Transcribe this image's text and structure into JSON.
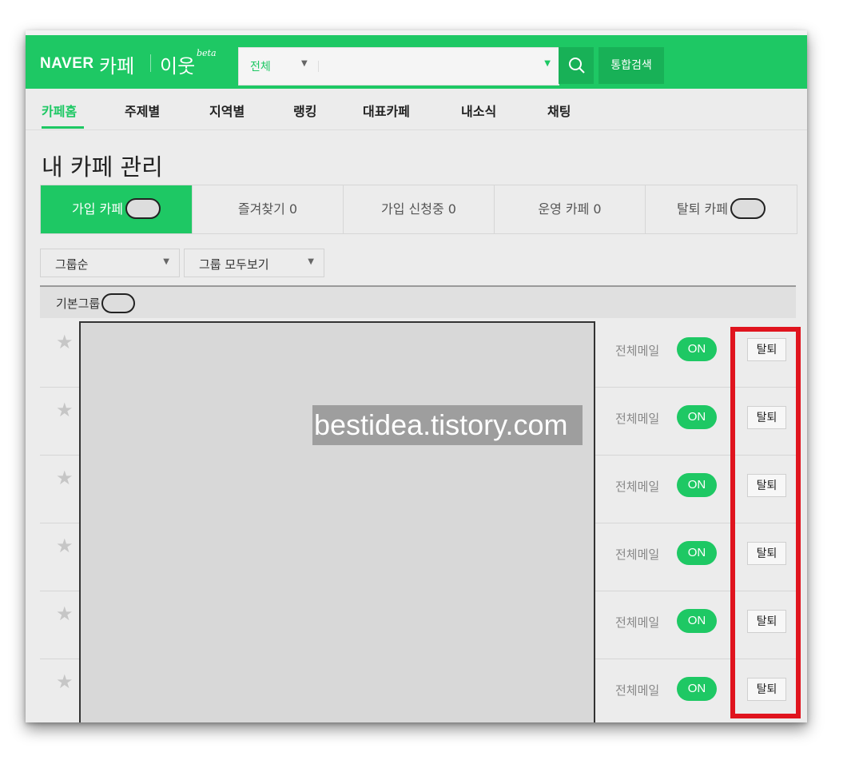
{
  "header": {
    "logo_naver": "NAVER",
    "logo_cafe": "카페",
    "logo_iut": "이웃",
    "logo_beta": "beta",
    "search_scope": "전체",
    "search_placeholder": "",
    "unified_search_label": "통합검색",
    "brand_color": "#1ec864"
  },
  "nav": {
    "items": [
      {
        "label": "카페홈",
        "active": true
      },
      {
        "label": "주제별"
      },
      {
        "label": "지역별"
      },
      {
        "label": "랭킹"
      },
      {
        "label": "대표카페"
      },
      {
        "label": "내소식"
      },
      {
        "label": "채팅"
      }
    ]
  },
  "page_title": "내 카페 관리",
  "tabs": [
    {
      "label": "가입 카페",
      "active": true
    },
    {
      "label": "즐겨찾기 0"
    },
    {
      "label": "가입 신청중 0"
    },
    {
      "label": "운영 카페 0"
    },
    {
      "label": "탈퇴 카페"
    }
  ],
  "filters": {
    "sort_label": "그룹순",
    "group_label": "그룹 모두보기"
  },
  "group": {
    "label": "기본그룹"
  },
  "rows": [
    {
      "mail_label": "전체메일",
      "toggle": "ON",
      "leave_label": "탈퇴"
    },
    {
      "mail_label": "전체메일",
      "toggle": "ON",
      "leave_label": "탈퇴"
    },
    {
      "mail_label": "전체메일",
      "toggle": "ON",
      "leave_label": "탈퇴"
    },
    {
      "mail_label": "전체메일",
      "toggle": "ON",
      "leave_label": "탈퇴"
    },
    {
      "mail_label": "전체메일",
      "toggle": "ON",
      "leave_label": "탈퇴"
    },
    {
      "mail_label": "전체메일",
      "toggle": "ON",
      "leave_label": "탈퇴"
    }
  ],
  "watermark": "bestidea.tistory.com",
  "highlight_color": "#e0141e"
}
